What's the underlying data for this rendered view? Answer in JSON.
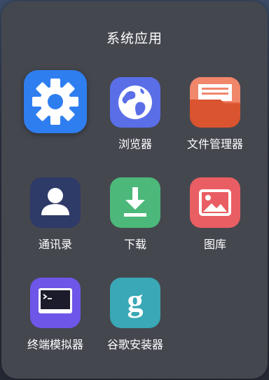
{
  "folder": {
    "title": "系统应用"
  },
  "apps": [
    {
      "label": "",
      "icon": "gear-icon",
      "color": "#2f7ef0"
    },
    {
      "label": "浏览器",
      "icon": "globe-icon",
      "color": "#5a6ee8"
    },
    {
      "label": "文件管理器",
      "icon": "folder-icon",
      "color": "#e2603e"
    },
    {
      "label": "通讯录",
      "icon": "person-icon",
      "color": "#2e3a68"
    },
    {
      "label": "下载",
      "icon": "download-icon",
      "color": "#4cb87a"
    },
    {
      "label": "图库",
      "icon": "image-icon",
      "color": "#e95e63"
    },
    {
      "label": "终端模拟器",
      "icon": "terminal-icon",
      "color": "#6e56e8"
    },
    {
      "label": "谷歌安装器",
      "icon": "google-g-icon",
      "color": "#3aa8b6"
    }
  ]
}
